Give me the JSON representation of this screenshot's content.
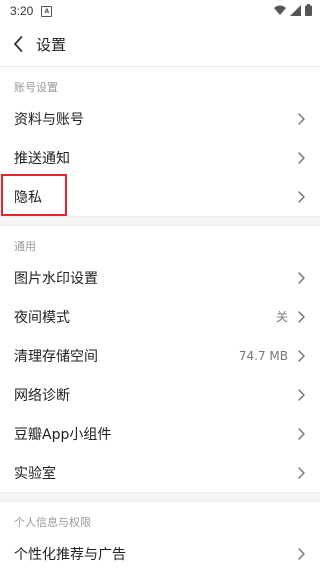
{
  "status": {
    "time": "3:20",
    "notif_badge": "A"
  },
  "header": {
    "title": "设置",
    "back_icon": "chevron-left-icon"
  },
  "sections": [
    {
      "title": "账号设置",
      "items": [
        {
          "label": "资料与账号",
          "value": ""
        },
        {
          "label": "推送通知",
          "value": ""
        },
        {
          "label": "隐私",
          "value": ""
        }
      ]
    },
    {
      "title": "通用",
      "items": [
        {
          "label": "图片水印设置",
          "value": ""
        },
        {
          "label": "夜间模式",
          "value": "关"
        },
        {
          "label": "清理存储空间",
          "value": "74.7 MB"
        },
        {
          "label": "网络诊断",
          "value": ""
        },
        {
          "label": "豆瓣App小组件",
          "value": ""
        },
        {
          "label": "实验室",
          "value": ""
        }
      ]
    },
    {
      "title": "个人信息与权限",
      "items": [
        {
          "label": "个性化推荐与广告",
          "value": ""
        }
      ]
    }
  ],
  "highlight_color": "#e0262a"
}
